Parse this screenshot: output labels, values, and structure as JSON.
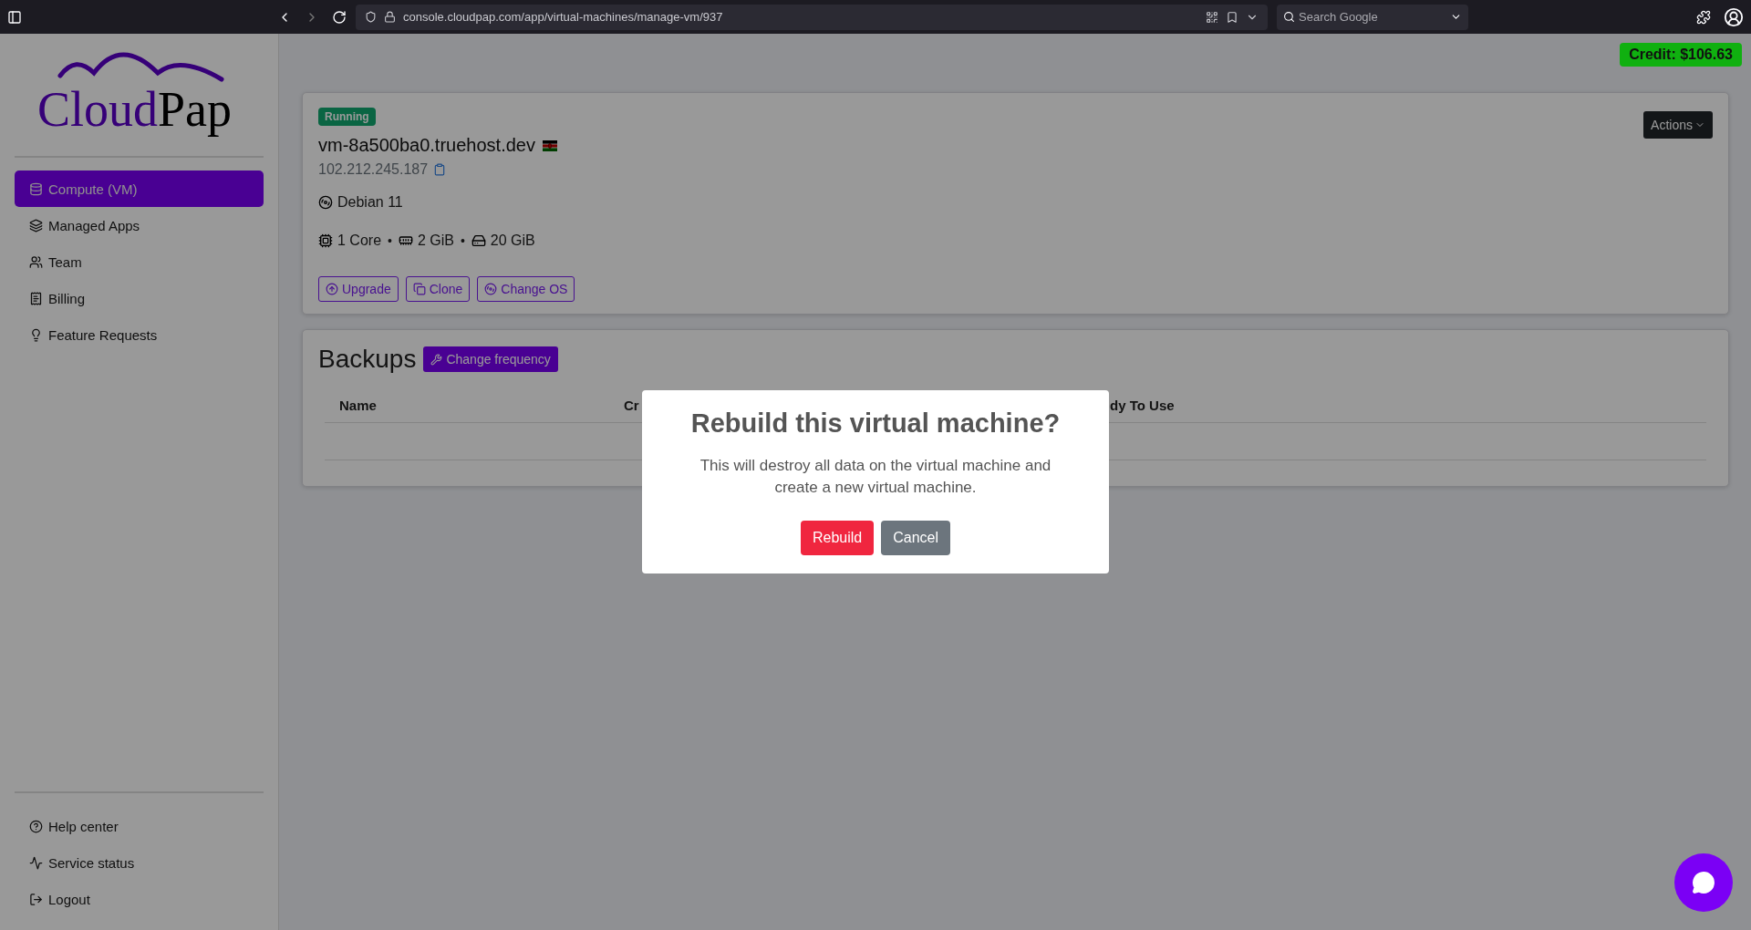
{
  "browser": {
    "url": "console.cloudpap.com/app/virtual-machines/manage-vm/937",
    "search": {
      "placeholder": "Search Google"
    }
  },
  "credit": "Credit: $106.63",
  "sidebar": {
    "logo": {
      "accent": "Cloud",
      "rest": "Pap"
    },
    "items": [
      {
        "label": "Compute (VM)",
        "selected": true
      },
      {
        "label": "Managed Apps",
        "selected": false
      },
      {
        "label": "Team",
        "selected": false
      },
      {
        "label": "Billing",
        "selected": false
      },
      {
        "label": "Feature Requests",
        "selected": false
      }
    ],
    "footer_items": [
      "Help center",
      "Service status",
      "Logout"
    ]
  },
  "vm": {
    "status": "Running",
    "hostname": "vm-8a500ba0.truehost.dev",
    "ip": "102.212.245.187",
    "os": "Debian 11",
    "specs": [
      "1 Core",
      "2 GiB",
      "20 GiB"
    ],
    "spec_separators": [
      "•",
      "•"
    ],
    "actions": [
      "Upgrade",
      "Clone",
      "Change OS"
    ],
    "menu_button": "Actions"
  },
  "backups": {
    "title": "Backups",
    "button": "Change frequency",
    "columns": [
      "Name",
      "Cr",
      "dy To Use"
    ]
  },
  "modal": {
    "title": "Rebuild this virtual machine?",
    "message": "This will destroy all data on the virtual machine and create a new virtual machine.",
    "buttons": [
      {
        "label": "Rebuild",
        "kind": "danger"
      },
      {
        "label": "Cancel",
        "kind": "secondary"
      }
    ]
  }
}
